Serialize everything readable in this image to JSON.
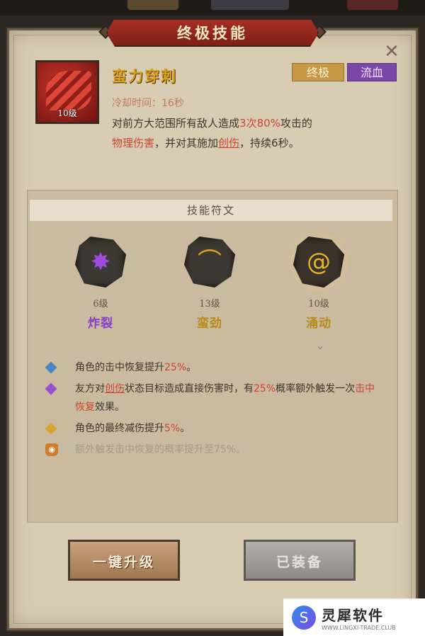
{
  "dialog": {
    "title": "终极技能",
    "close_icon": "close-icon"
  },
  "skill": {
    "name": "蛮力穿刺",
    "level_label": "10级",
    "tags": [
      "终极",
      "流血"
    ],
    "cooldown": "冷却时间：16秒",
    "description": {
      "p1": "对前方大范围所有敌人造成",
      "hits": "3次",
      "pct": "80%",
      "p2": "攻击的",
      "dmg_type": "物理伤害",
      "p3": "，并对其施加",
      "status": "创伤",
      "p4": "，持续6秒。"
    }
  },
  "runes": {
    "header": "技能符文",
    "items": [
      {
        "level": "6级",
        "name": "炸裂",
        "icon": "splat-icon",
        "color": "#8a3fc7",
        "selected": false
      },
      {
        "level": "13级",
        "name": "蛮劲",
        "icon": "claw-icon",
        "color": "#b98a17",
        "selected": false
      },
      {
        "level": "10级",
        "name": "涌动",
        "icon": "swirl-icon",
        "color": "#b98a17",
        "selected": true
      }
    ]
  },
  "effects": [
    {
      "pre": "角色的击中恢复提升",
      "hl": "25%",
      "post": "。",
      "icon": "diamond-blue-icon"
    },
    {
      "p1": "友方对",
      "u1": "创伤",
      "p2": "状态目标造成直接伤害时，有",
      "hl": "25%",
      "p3": "概率额外触发一次",
      "u2": "击中恢复",
      "p4": "效果。",
      "icon": "diamond-purple-icon"
    },
    {
      "pre": "角色的最终减伤提升",
      "hl": "5%",
      "post": "。",
      "icon": "diamond-gold-icon"
    },
    {
      "text": "额外触发击中恢复的概率提升至75%。",
      "icon": "lock-icon",
      "locked": true
    }
  ],
  "buttons": {
    "upgrade": "一键升级",
    "equipped": "已装备"
  },
  "watermark": {
    "name": "灵犀软件",
    "url": "WWW.LINGXI-TRADE.CLUB"
  },
  "colors": {
    "accent_red": "#c9472e",
    "purple": "#8a3fc7",
    "gold": "#b98a17"
  }
}
